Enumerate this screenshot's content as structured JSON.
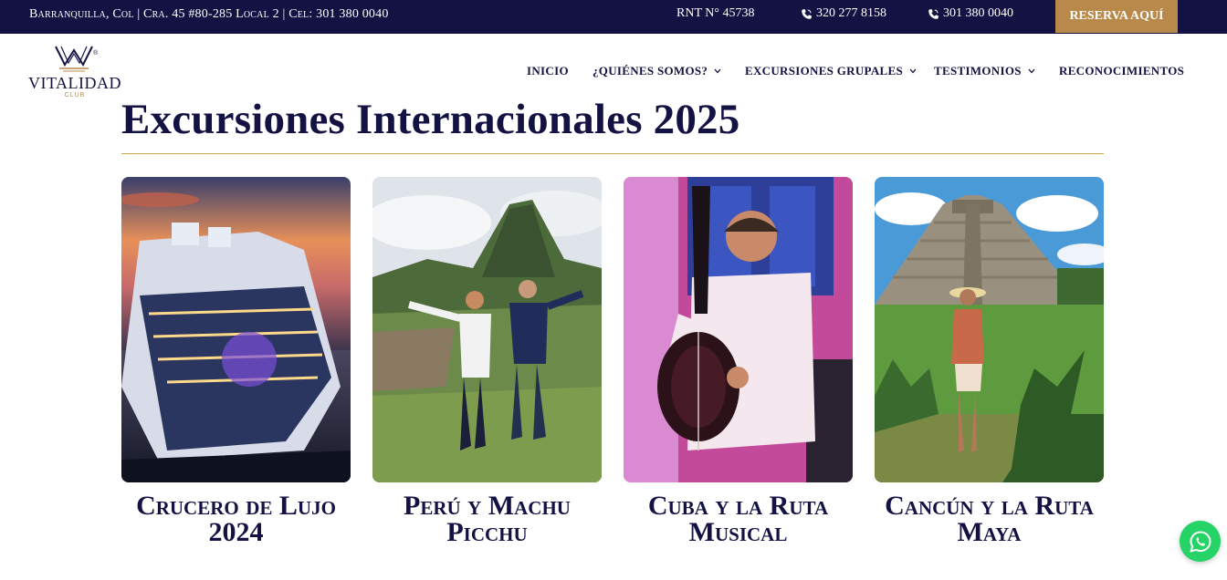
{
  "topbar": {
    "address": "Barranquilla, Col | Cra. 45 #80-285 Local 2 | Cel: 301 380 0040",
    "rnt": "RNT N° 45738",
    "phone1": "320 277 8158",
    "phone2": "301 380 0040",
    "reserve_label": "RESERVA AQUÍ"
  },
  "logo": {
    "name": "VITALIDAD",
    "club": "CLUB",
    "reg": "®"
  },
  "nav": {
    "items": [
      {
        "label": "INICIO"
      },
      {
        "label": "¿QUIÉNES SOMOS?"
      },
      {
        "label": "EXCURSIONES GRUPALES"
      },
      {
        "label": "TESTIMONIOS"
      },
      {
        "label": "RECONOCIMIENTOS"
      }
    ]
  },
  "main": {
    "title": "Excursiones Internacionales 2025",
    "cards": [
      {
        "title": "Crucero de Lujo 2024",
        "image_icon": "cruise-ship-photo"
      },
      {
        "title": "Perú y Machu Picchu",
        "image_icon": "machu-picchu-photo"
      },
      {
        "title": "Cuba y la Ruta Musical",
        "image_icon": "cuba-musician-photo"
      },
      {
        "title": "Cancún y la Ruta Maya",
        "image_icon": "chichen-itza-photo"
      }
    ]
  },
  "colors": {
    "navy": "#131243",
    "gold": "#b8894a",
    "whatsapp": "#25d366"
  }
}
